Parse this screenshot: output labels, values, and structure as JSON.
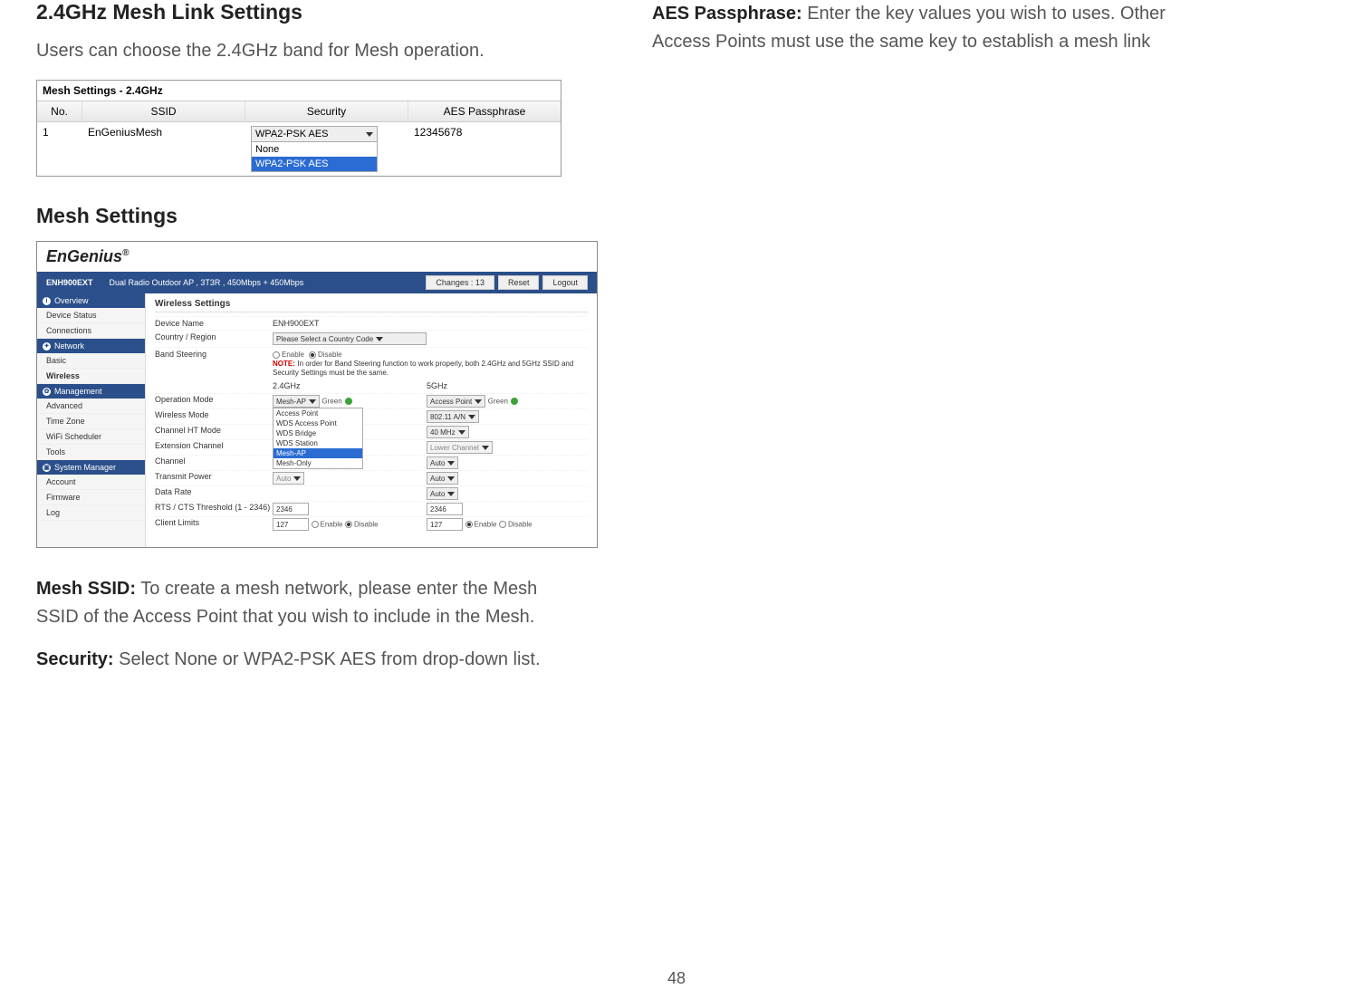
{
  "page_number": "48",
  "left": {
    "heading_linksettings": "2.4GHz Mesh Link Settings",
    "intro_text": "Users can choose the 2.4GHz band for Mesh operation.",
    "mesh_table": {
      "title": "Mesh Settings - 2.4GHz",
      "headers": {
        "no": "No.",
        "ssid": "SSID",
        "security": "Security",
        "aes": "AES Passphrase"
      },
      "row": {
        "no": "1",
        "ssid": "EnGeniusMesh",
        "selected": "WPA2-PSK AES",
        "options": [
          "None",
          "WPA2-PSK AES"
        ],
        "aes": "12345678"
      }
    },
    "heading_meshsettings": "Mesh Settings",
    "ui": {
      "logo": "EnGenius",
      "logo_reg": "®",
      "bar": {
        "model": "ENH900EXT",
        "desc": "Dual Radio Outdoor AP , 3T3R , 450Mbps + 450Mbps",
        "changes": "Changes : 13",
        "reset": "Reset",
        "logout": "Logout"
      },
      "side": {
        "overview": "Overview",
        "device_status": "Device Status",
        "connections": "Connections",
        "network": "Network",
        "basic": "Basic",
        "wireless": "Wireless",
        "management": "Management",
        "advanced": "Advanced",
        "time_zone": "Time Zone",
        "wifi_scheduler": "WiFi Scheduler",
        "tools": "Tools",
        "system_manager": "System Manager",
        "account": "Account",
        "firmware": "Firmware",
        "log": "Log"
      },
      "main": {
        "title": "Wireless Settings",
        "device_name_lbl": "Device Name",
        "device_name_val": "ENH900EXT",
        "country_lbl": "Country / Region",
        "country_val": "Please Select a Country Code",
        "band_steering_lbl": "Band Steering",
        "enable": "Enable",
        "disable": "Disable",
        "note_lbl": "NOTE:",
        "note_text": "In order for Band Steering function to work properly, both 2.4GHz and 5GHz SSID and Security Settings must be the same.",
        "col24": "2.4GHz",
        "col5": "5GHz",
        "rows": {
          "op_mode": "Operation Mode",
          "wireless_mode": "Wireless Mode",
          "channel_ht": "Channel HT Mode",
          "ext_channel": "Extension Channel",
          "channel": "Channel",
          "tx_power": "Transmit Power",
          "data_rate": "Data Rate",
          "rts": "RTS / CTS Threshold (1 - 2346)",
          "client_limits": "Client Limits"
        },
        "v24": {
          "op_mode_sel": "Mesh-AP",
          "green_lbl": "Green",
          "op_options": [
            "Access Point",
            "WDS Access Point",
            "WDS Bridge",
            "WDS Station",
            "Mesh-AP",
            "Mesh-Only"
          ],
          "tx_power": "Auto",
          "rts": "2346",
          "client_limits": "127"
        },
        "v5": {
          "op_mode_sel": "Access Point",
          "green_lbl": "Green",
          "wireless_mode": "802.11 A/N",
          "channel_ht": "40 MHz",
          "ext_channel": "Lower Channel",
          "channel": "Auto",
          "tx_power": "Auto",
          "data_rate": "Auto",
          "rts": "2346",
          "client_limits": "127"
        }
      }
    },
    "mesh_ssid_label": "Mesh SSID:",
    "mesh_ssid_text": " To create a mesh network, please enter the Mesh SSID of the Access Point that you wish to include in the Mesh.",
    "security_label": "Security:",
    "security_text": " Select None or WPA2-PSK AES from drop-down list."
  },
  "right": {
    "aes_label": "AES Passphrase:",
    "aes_text": " Enter the key values you wish to uses. Other Access Points must use the same key to establish a mesh link"
  }
}
